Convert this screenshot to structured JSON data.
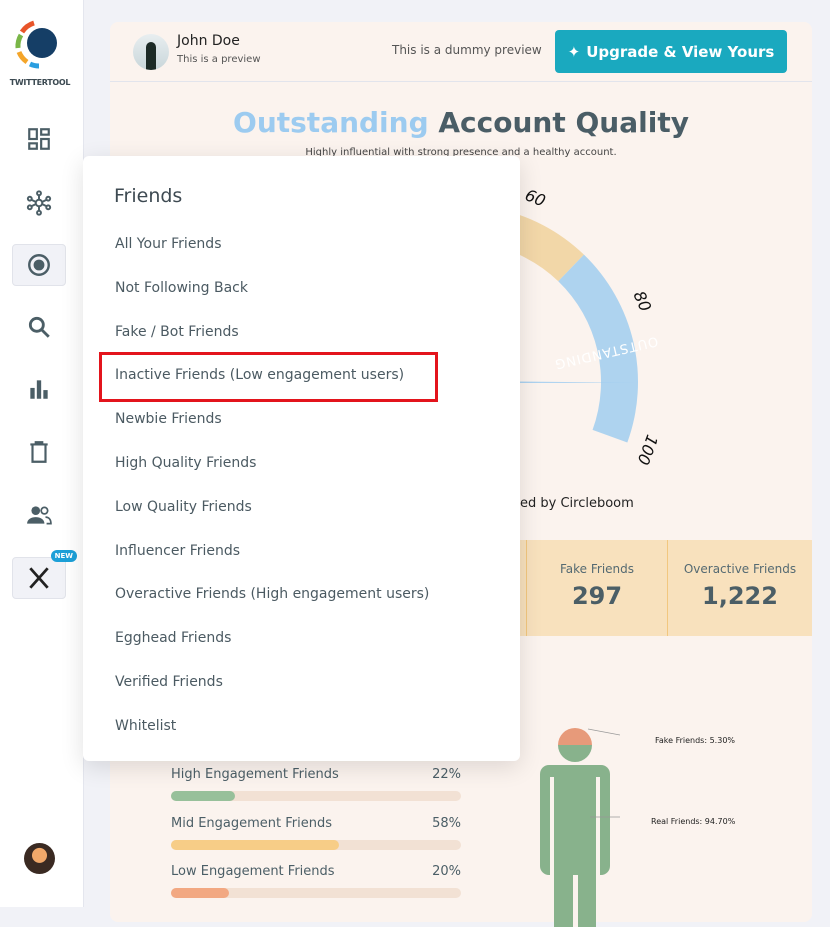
{
  "sidebar": {
    "logo_text": "TWITTERTOOL",
    "items": [
      {
        "icon": "dashboard-icon"
      },
      {
        "icon": "network-icon"
      },
      {
        "icon": "circle-target-icon",
        "active": true
      },
      {
        "icon": "search-icon"
      },
      {
        "icon": "bar-chart-icon"
      },
      {
        "icon": "trash-icon"
      },
      {
        "icon": "users-icon"
      },
      {
        "icon": "x-logo-icon",
        "badge": "NEW"
      }
    ]
  },
  "header": {
    "user_name": "John Doe",
    "user_sub": "This is a preview",
    "dummy_text": "This is a dummy preview",
    "upgrade_label": "Upgrade & View Yours"
  },
  "quality": {
    "title_highlight": "Outstanding",
    "title_rest": "Account Quality",
    "subtitle": "Highly influential with strong presence and a healthy account.",
    "gauge_labels": [
      "60",
      "80",
      "100"
    ],
    "band_label": "OUTSTANDING",
    "value": 91,
    "powered": "ed by Circleboom"
  },
  "stats": [
    {
      "label": "Fake Friends",
      "value": "297"
    },
    {
      "label": "Overactive Friends",
      "value": "1,222"
    }
  ],
  "engagement": [
    {
      "label": "High Engagement Friends",
      "pct": "22%",
      "value": 22,
      "color": "#97c09a"
    },
    {
      "label": "Mid Engagement Friends",
      "pct": "58%",
      "value": 58,
      "color": "#f7cd87"
    },
    {
      "label": "Low Engagement Friends",
      "pct": "20%",
      "value": 20,
      "color": "#f2a882"
    }
  ],
  "figure": {
    "fake_label": "Fake Friends: 5.30%",
    "real_label": "Real Friends: 94.70%",
    "fake": 5.3,
    "real": 94.7
  },
  "menu": {
    "title": "Friends",
    "items": [
      "All Your Friends",
      "Not Following Back",
      "Fake / Bot Friends",
      "Inactive Friends (Low engagement users)",
      "Newbie Friends",
      "High Quality Friends",
      "Low Quality Friends",
      "Influencer Friends",
      "Overactive Friends (High engagement users)",
      "Egghead Friends",
      "Verified Friends",
      "Whitelist"
    ],
    "highlighted": 3
  },
  "colors": {
    "accent": "#1aa9bf",
    "highlight_border": "#e3141c",
    "outstanding": "#9ccbf0"
  }
}
